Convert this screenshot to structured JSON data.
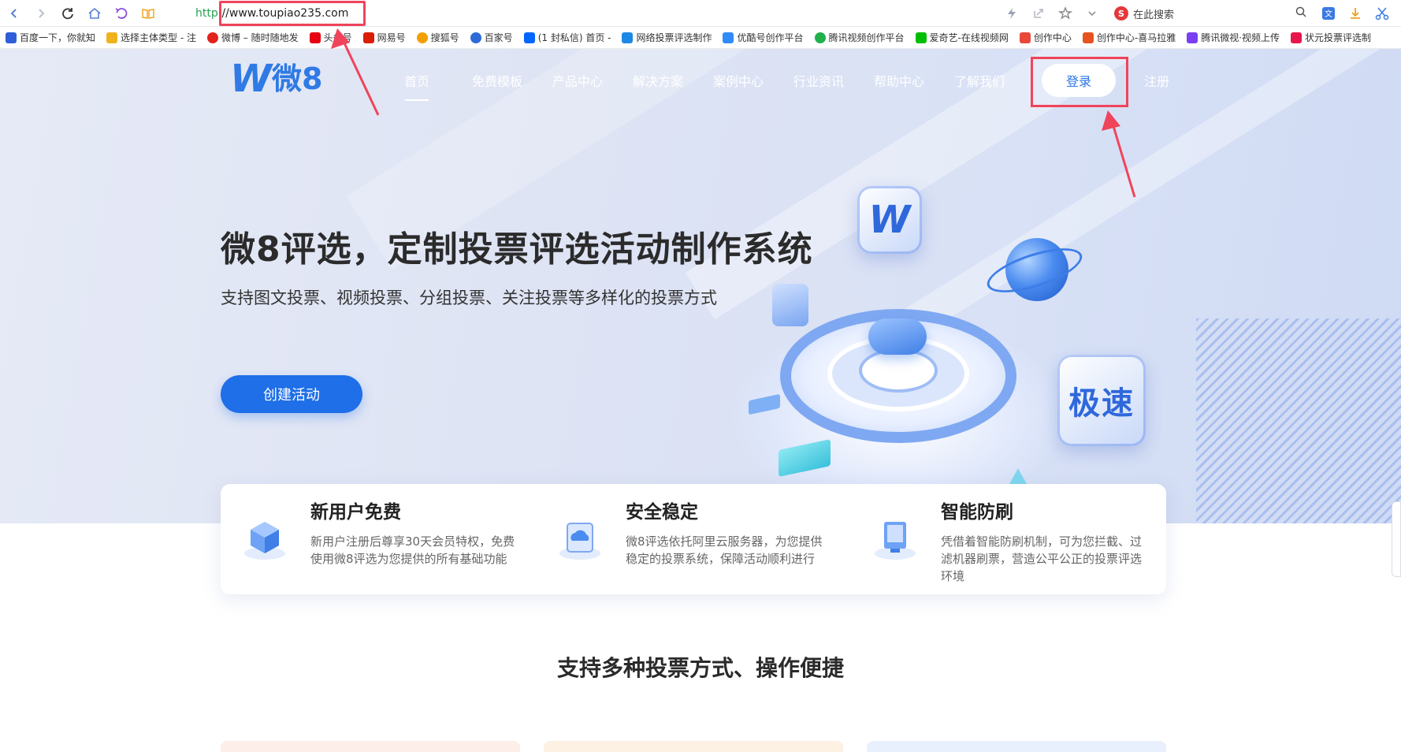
{
  "browser": {
    "address_scheme": "http:",
    "address_url": "//www.toupiao235.com",
    "search_placeholder": "在此搜索",
    "search_engine_icon": "S",
    "icons": [
      "back-icon",
      "forward-icon",
      "refresh-icon",
      "home-icon",
      "undo-icon",
      "reader-icon",
      "lightning-icon",
      "share-icon",
      "star-icon",
      "chevron-down-icon",
      "search-icon",
      "translate-icon",
      "download-icon",
      "scissors-icon"
    ]
  },
  "bookmarks": [
    {
      "label": "百度一下，你就知",
      "color": "#2f5fd8"
    },
    {
      "label": "选择主体类型 - 注",
      "color": "#f0b21c"
    },
    {
      "label": "微博 – 随时随地发",
      "color": "#e2231a"
    },
    {
      "label": "头条号",
      "color": "#e60012"
    },
    {
      "label": "网易号",
      "color": "#d81e06"
    },
    {
      "label": "搜狐号",
      "color": "#f2a000"
    },
    {
      "label": "百家号",
      "color": "#2f6bd8"
    },
    {
      "label": "(1 封私信) 首页 -",
      "color": "#0066ff"
    },
    {
      "label": "网络投票评选制作",
      "color": "#1e88e5"
    },
    {
      "label": "优酷号创作平台",
      "color": "#2f8bf7"
    },
    {
      "label": "腾讯视频创作平台",
      "color": "#20b04c"
    },
    {
      "label": "爱奇艺-在线视频网",
      "color": "#00be06"
    },
    {
      "label": "创作中心",
      "color": "#e8483a"
    },
    {
      "label": "创作中心-喜马拉雅",
      "color": "#e5541e"
    },
    {
      "label": "腾讯微视·视频上传",
      "color": "#7a3ff2"
    },
    {
      "label": "状元投票评选制",
      "color": "#e8174b"
    }
  ],
  "site": {
    "logo_mark": "W",
    "logo_text": "微8",
    "nav": [
      {
        "label": "首页",
        "active": true
      },
      {
        "label": "免费模板"
      },
      {
        "label": "产品中心"
      },
      {
        "label": "解决方案"
      },
      {
        "label": "案例中心"
      },
      {
        "label": "行业资讯"
      },
      {
        "label": "帮助中心"
      },
      {
        "label": "了解我们"
      }
    ],
    "login_label": "登录",
    "register_label": "注册"
  },
  "hero": {
    "title": "微8评选，定制投票评选活动制作系统",
    "subtitle": "支持图文投票、视频投票、分组投票、关注投票等多样化的投票方式",
    "cta_label": "创建活动",
    "badge_speed": "极速",
    "badge_logo": "W"
  },
  "features": [
    {
      "title": "新用户免费",
      "desc": "新用户注册后尊享30天会员特权，免费使用微8评选为您提供的所有基础功能",
      "icon": "cubes-icon"
    },
    {
      "title": "安全稳定",
      "desc": "微8评选依托阿里云服务器，为您提供稳定的投票系统，保障活动顺利进行",
      "icon": "cloud-server-icon"
    },
    {
      "title": "智能防刷",
      "desc": "凭借着智能防刷机制，可为您拦截、过滤机器刷票，营造公平公正的投票评选环境",
      "icon": "shield-monitor-icon"
    }
  ],
  "section_title": "支持多种投票方式、操作便捷",
  "colors": {
    "brand_blue": "#1f6fe8",
    "annotation_red": "#f0445b",
    "hero_bg": "#dde3f4"
  }
}
